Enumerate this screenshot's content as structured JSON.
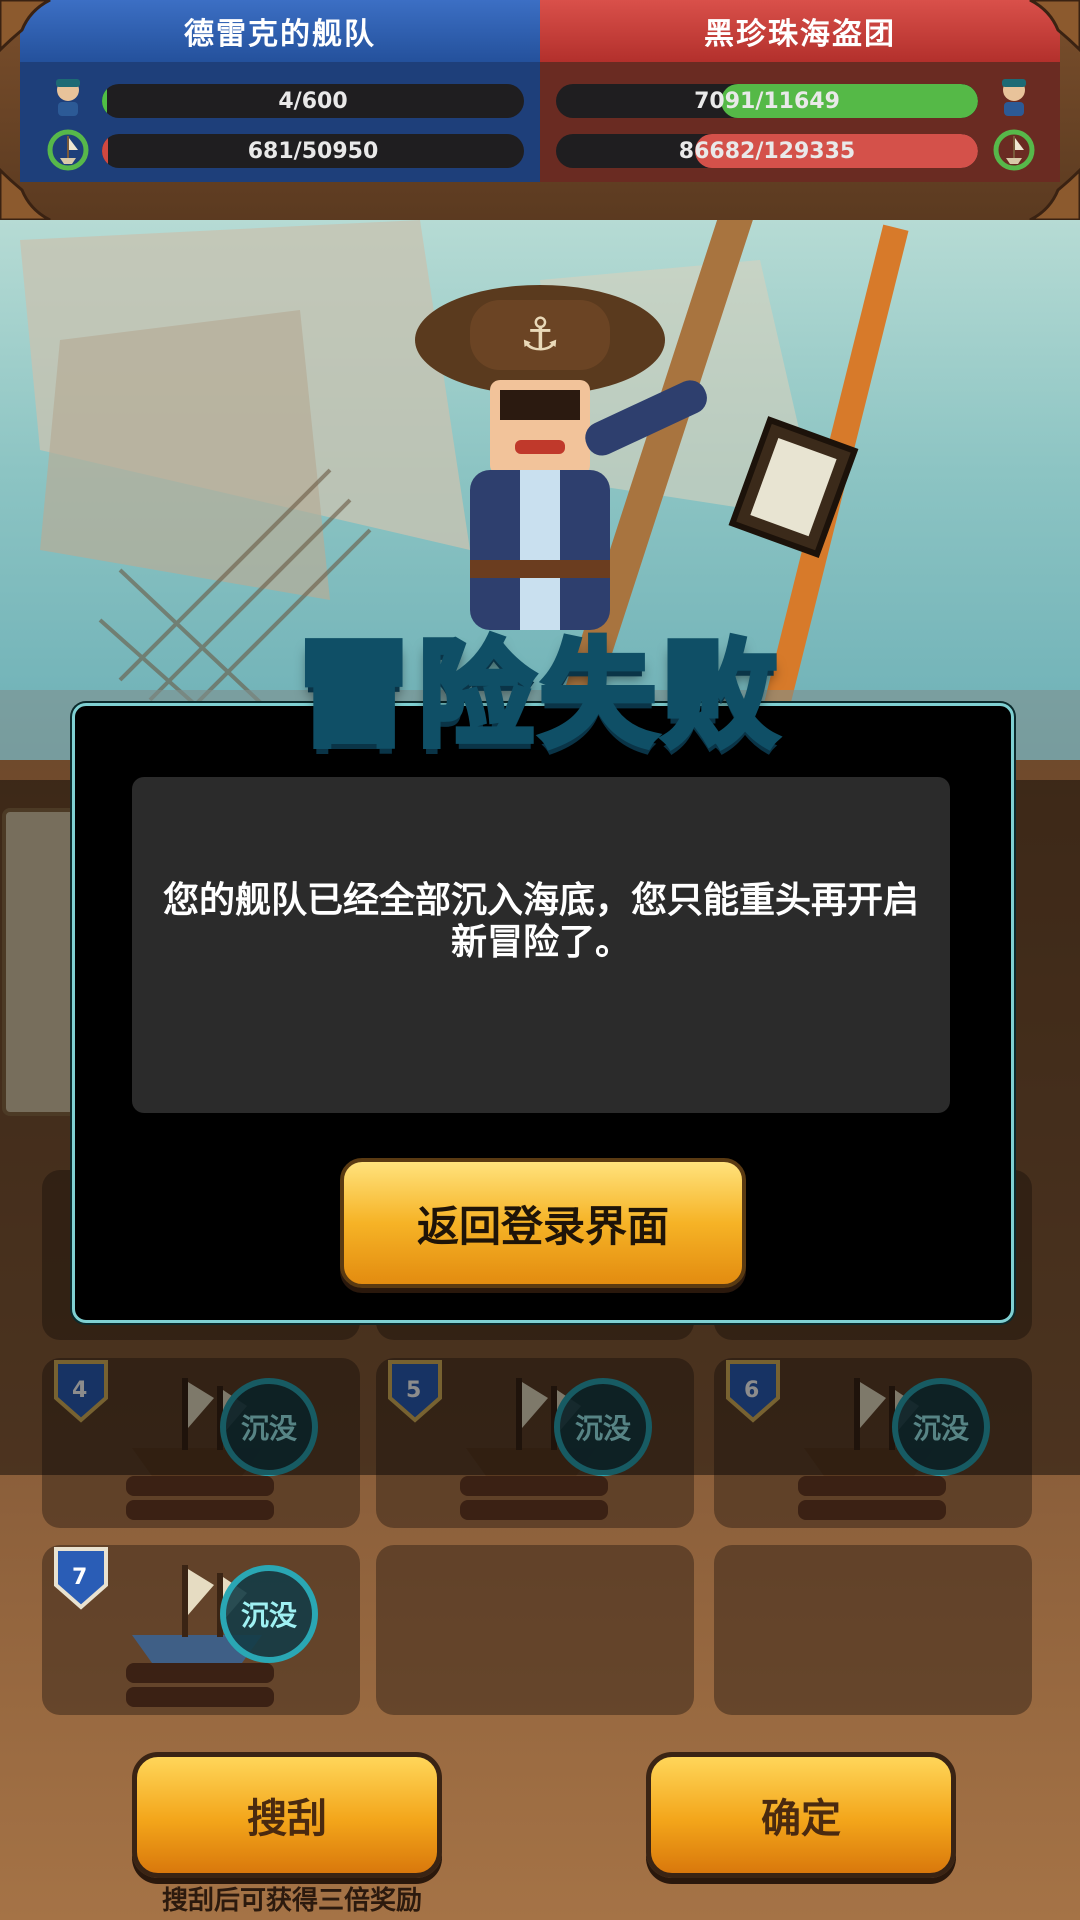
{
  "topbar": {
    "left_team": {
      "name": "德雷克的舰队",
      "crew": "4/600",
      "crew_fraction": 0.0067,
      "hull": "681/50950",
      "hull_fraction": 0.0134,
      "color": "#2f5aa8"
    },
    "right_team": {
      "name": "黑珍珠海盗团",
      "crew": "7091/11649",
      "crew_fraction": 0.609,
      "hull": "86682/129335",
      "hull_fraction": 0.67,
      "color": "#c23b37"
    },
    "icons": {
      "crew": "pirate-crew-icon",
      "ship": "ship-wheel-icon"
    }
  },
  "modal": {
    "title": "冒险失败",
    "message": "您的舰队已经全部沉入海底，您只能重头再开启新冒险了。",
    "button": "返回登录界面"
  },
  "slots": [
    {
      "number": "4",
      "status": "沉没"
    },
    {
      "number": "5",
      "status": "沉没"
    },
    {
      "number": "6",
      "status": "沉没"
    },
    {
      "number": "7",
      "status": "沉没"
    }
  ],
  "buttons": {
    "search": "搜刮",
    "confirm": "确定",
    "bonus_note": "搜刮后可获得三倍奖励"
  },
  "colors": {
    "accent_gold": "#f3a51a",
    "modal_border": "#7fd0d2",
    "sunk_ring": "#2aa7b4"
  }
}
